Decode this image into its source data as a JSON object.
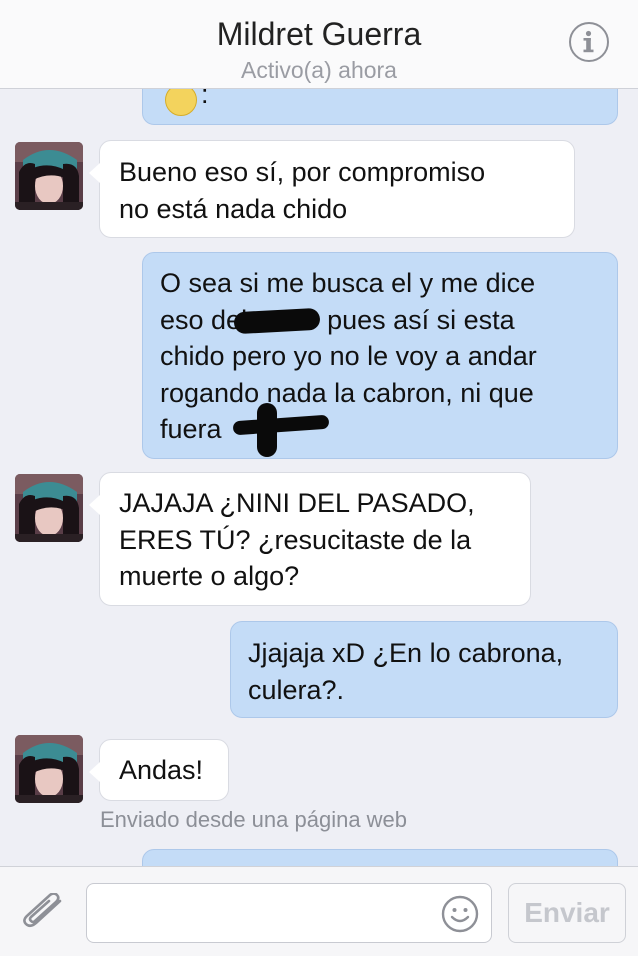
{
  "header": {
    "contact_name": "Mildret Guerra",
    "status": "Activo(a) ahora"
  },
  "messages": [
    {
      "from": "me",
      "text": ":"
    },
    {
      "from": "contact",
      "lines": [
        "Bueno eso sí, por compromiso",
        "no está nada chido"
      ]
    },
    {
      "from": "me",
      "lines": [
        "O sea si me busca el y me dice",
        "eso del",
        "pues así si esta",
        "chido pero yo no le voy a andar",
        "rogando nada la cabron, ni que",
        "fuera"
      ]
    },
    {
      "from": "contact",
      "lines": [
        "JAJAJA ¿NINI DEL PASADO,",
        "ERES TÚ? ¿resucitaste de la",
        "muerte o algo?"
      ]
    },
    {
      "from": "me",
      "lines": [
        "Jjajaja xD ¿En lo cabrona,",
        "culera?."
      ]
    },
    {
      "from": "contact",
      "lines": [
        "Andas!"
      ],
      "meta": "Enviado desde una página web"
    }
  ],
  "composer": {
    "send_label": "Enviar"
  },
  "icons": {
    "info": "info-icon",
    "attach": "paperclip-icon",
    "emoji": "smiley-icon"
  },
  "colors": {
    "outgoing_bubble": "#c4dcf7",
    "incoming_bubble": "#ffffff",
    "background": "#eeeff5"
  }
}
